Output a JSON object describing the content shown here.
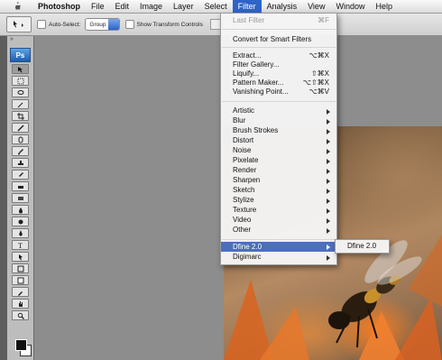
{
  "menubar": {
    "app_name": "Photoshop",
    "items": [
      "File",
      "Edit",
      "Image",
      "Layer",
      "Select",
      "Filter",
      "Analysis",
      "View",
      "Window",
      "Help"
    ],
    "active": "Filter"
  },
  "options_bar": {
    "auto_select_label": "Auto-Select:",
    "auto_select_value": "Group",
    "show_transform_label": "Show Transform Controls"
  },
  "toolbox": {
    "logo": "Ps"
  },
  "filter_menu": {
    "last_filter": {
      "label": "Last Filter",
      "shortcut": "⌘F"
    },
    "convert": "Convert for Smart Filters",
    "group2": [
      {
        "label": "Extract...",
        "shortcut": "⌥⌘X"
      },
      {
        "label": "Filter Gallery...",
        "shortcut": ""
      },
      {
        "label": "Liquify...",
        "shortcut": "⇧⌘X"
      },
      {
        "label": "Pattern Maker...",
        "shortcut": "⌥⇧⌘X"
      },
      {
        "label": "Vanishing Point...",
        "shortcut": "⌥⌘V"
      }
    ],
    "group3": [
      "Artistic",
      "Blur",
      "Brush Strokes",
      "Distort",
      "Noise",
      "Pixelate",
      "Render",
      "Sharpen",
      "Sketch",
      "Stylize",
      "Texture",
      "Video",
      "Other"
    ],
    "group4": [
      "Dfine 2.0",
      "Digimarc"
    ],
    "highlighted": "Dfine 2.0"
  },
  "submenu": {
    "item": "Dfine 2.0"
  }
}
